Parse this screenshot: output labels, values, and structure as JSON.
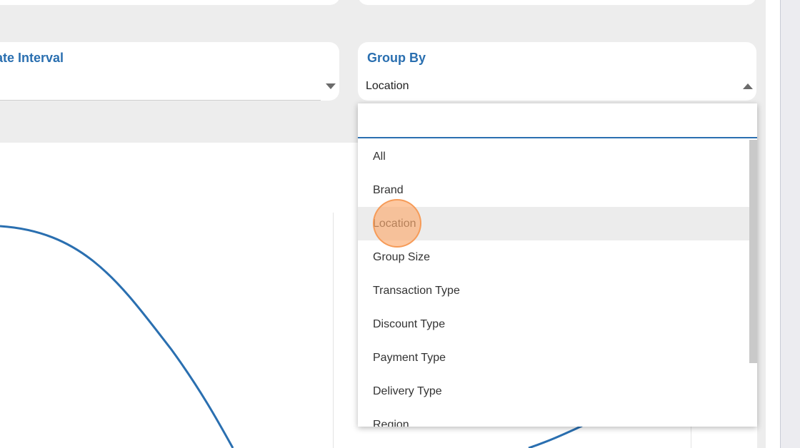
{
  "filters": {
    "date_interval": {
      "title": "Date Interval",
      "visible_title": "ate Interval",
      "value": ""
    },
    "group_by": {
      "title": "Group By",
      "value": "Location"
    }
  },
  "dropdown": {
    "search_value": "",
    "options": [
      "All",
      "Brand",
      "Location",
      "Group Size",
      "Transaction Type",
      "Discount Type",
      "Payment Type",
      "Delivery Type",
      "Region"
    ],
    "active_option": "Location"
  },
  "colors": {
    "accent": "#2a6fb0",
    "line": "#2a6fb0",
    "background": "#ededed",
    "hover": "#ececec",
    "click_indicator": "#fcaa6e"
  },
  "icons": {
    "date_interval_caret": "caret-down-icon",
    "group_by_caret": "caret-up-icon"
  }
}
